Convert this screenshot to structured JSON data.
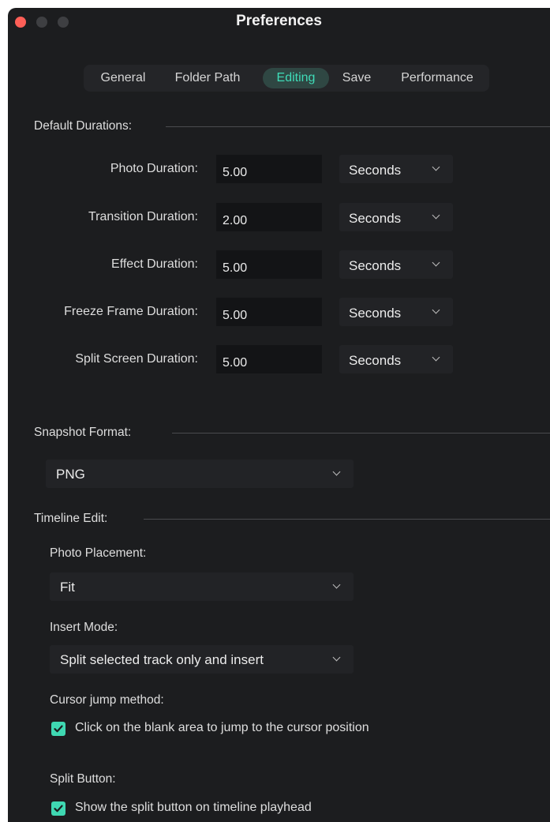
{
  "window": {
    "title": "Preferences"
  },
  "tabs": [
    {
      "label": "General",
      "active": false
    },
    {
      "label": "Folder Path",
      "active": false
    },
    {
      "label": "Editing",
      "active": true
    },
    {
      "label": "Save",
      "active": false
    },
    {
      "label": "Performance",
      "active": false
    }
  ],
  "default_durations": {
    "heading": "Default Durations:",
    "rows": [
      {
        "label": "Photo Duration:",
        "value": "5.00",
        "unit": "Seconds"
      },
      {
        "label": "Transition Duration:",
        "value": "2.00",
        "unit": "Seconds"
      },
      {
        "label": "Effect Duration:",
        "value": "5.00",
        "unit": "Seconds"
      },
      {
        "label": "Freeze Frame Duration:",
        "value": "5.00",
        "unit": "Seconds"
      },
      {
        "label": "Split Screen Duration:",
        "value": "5.00",
        "unit": "Seconds"
      }
    ]
  },
  "snapshot": {
    "heading": "Snapshot Format:",
    "value": "PNG"
  },
  "timeline_edit": {
    "heading": "Timeline Edit:",
    "photo_placement_label": "Photo Placement:",
    "photo_placement_value": "Fit",
    "insert_mode_label": "Insert Mode:",
    "insert_mode_value": "Split selected track only and insert",
    "cursor_jump_label": "Cursor jump method:",
    "cursor_jump_option": "Click on the blank area to jump to the cursor position",
    "cursor_jump_checked": true,
    "split_button_label": "Split Button:",
    "split_button_option": "Show the split button on timeline playhead",
    "split_button_checked": true
  },
  "colors": {
    "accent": "#3fdcb8",
    "window_bg": "#1c1d1f",
    "close_button": "#fe5f57"
  }
}
